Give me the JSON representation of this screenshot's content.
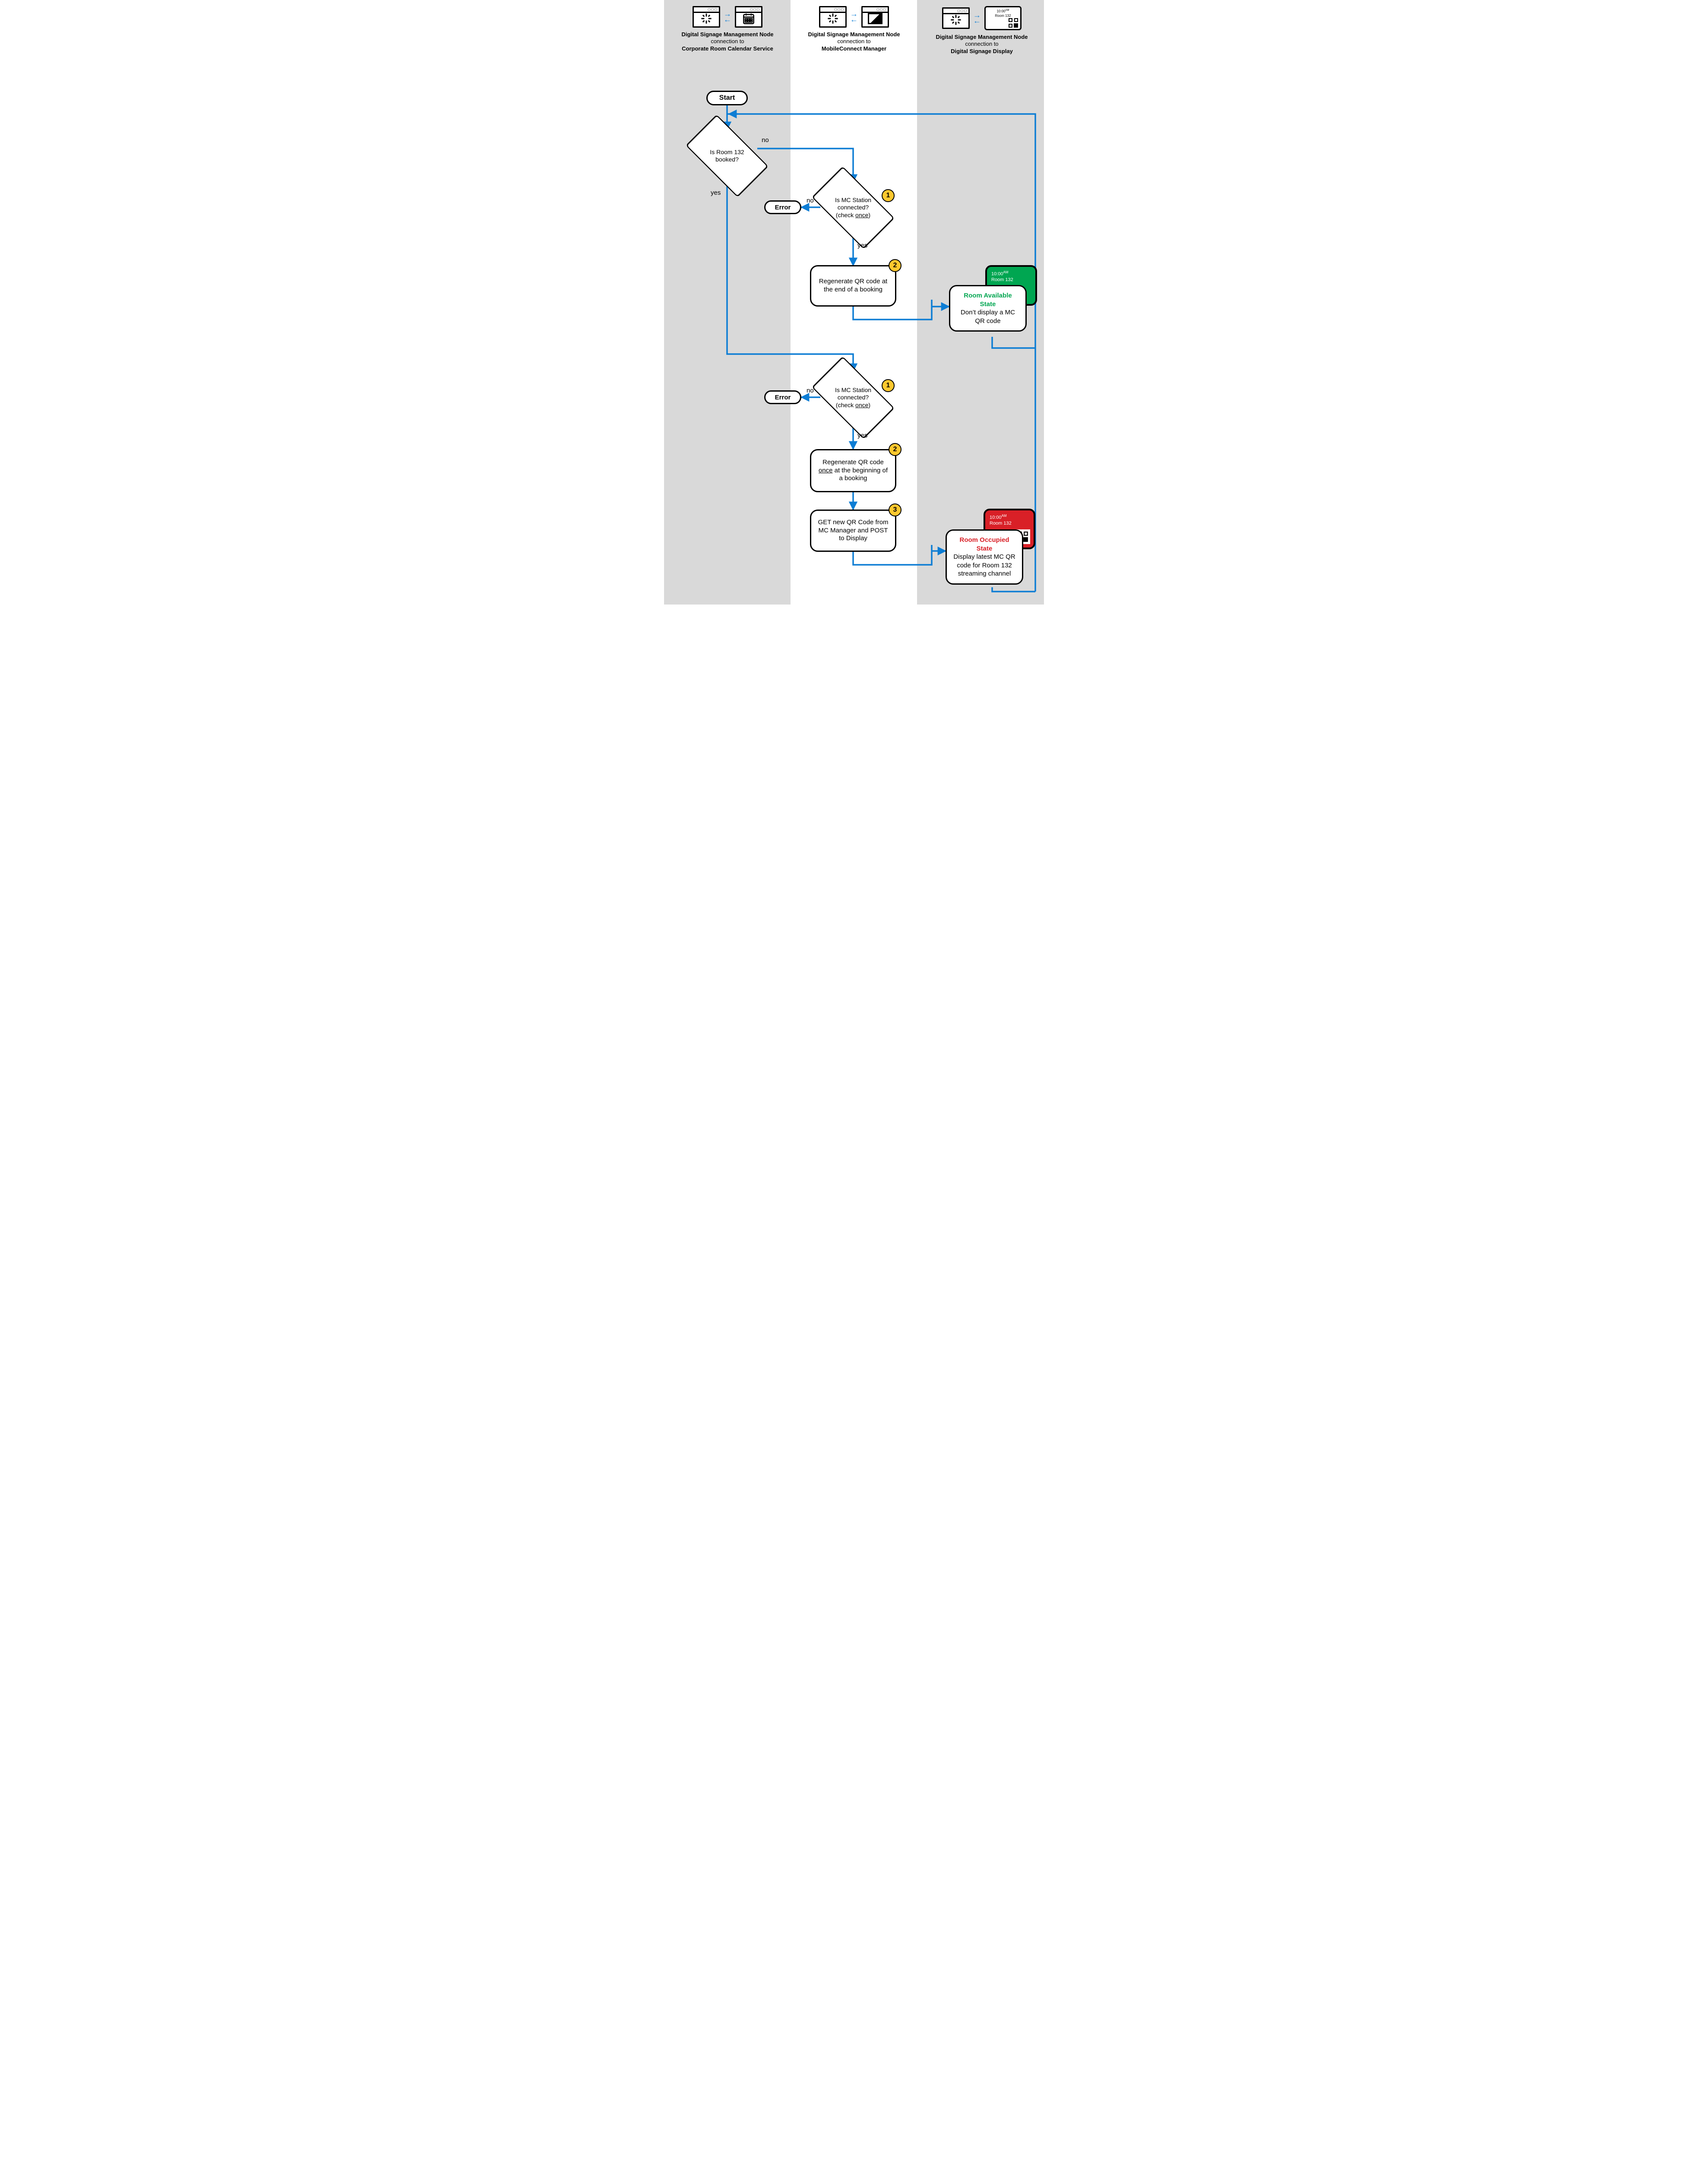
{
  "header": {
    "card1": {
      "line1": "Digital Signage Management Node",
      "line2": "connection to",
      "line3": "Corporate Room Calendar Service"
    },
    "card2": {
      "line1": "Digital Signage Management Node",
      "line2": "connection to",
      "line3": "MobileConnect Manager"
    },
    "card3": {
      "line1": "Digital Signage Management Node",
      "line2": "connection to",
      "line3": "Digital Signage Display",
      "screen_time": "10:00",
      "screen_time_suffix": "AM",
      "screen_room": "Room 132"
    }
  },
  "flow": {
    "start": "Start",
    "error": "Error",
    "q_booked": "Is Room 132 booked?",
    "q_connected_l1": "Is MC Station",
    "q_connected_l2": "connected?",
    "q_connected_l3_prefix": "(check ",
    "q_connected_l3_underline": "once",
    "q_connected_l3_suffix": ")",
    "p_regen_end": "Regenerate QR code at the end of a booking",
    "p_regen_begin_prefix": "Regenerate QR code ",
    "p_regen_begin_underline": "once",
    "p_regen_begin_suffix": " at the beginning of a booking",
    "p_get_post": "GET new QR Code from MC Manager and POST to Display",
    "labels": {
      "yes": "yes",
      "no": "no"
    },
    "badges": {
      "one": "1",
      "two": "2",
      "three": "3"
    },
    "state_available": {
      "title": "Room Available State",
      "body": "Don’t display a MC QR code",
      "screen_time": "10:00",
      "screen_time_suffix": "AM",
      "screen_room": "Room 132"
    },
    "state_occupied": {
      "title": "Room Occupied State",
      "body": "Display latest MC QR code for Room 132 streaming channel",
      "screen_time": "10:00",
      "screen_time_suffix": "AM",
      "screen_room": "Room 132"
    }
  }
}
